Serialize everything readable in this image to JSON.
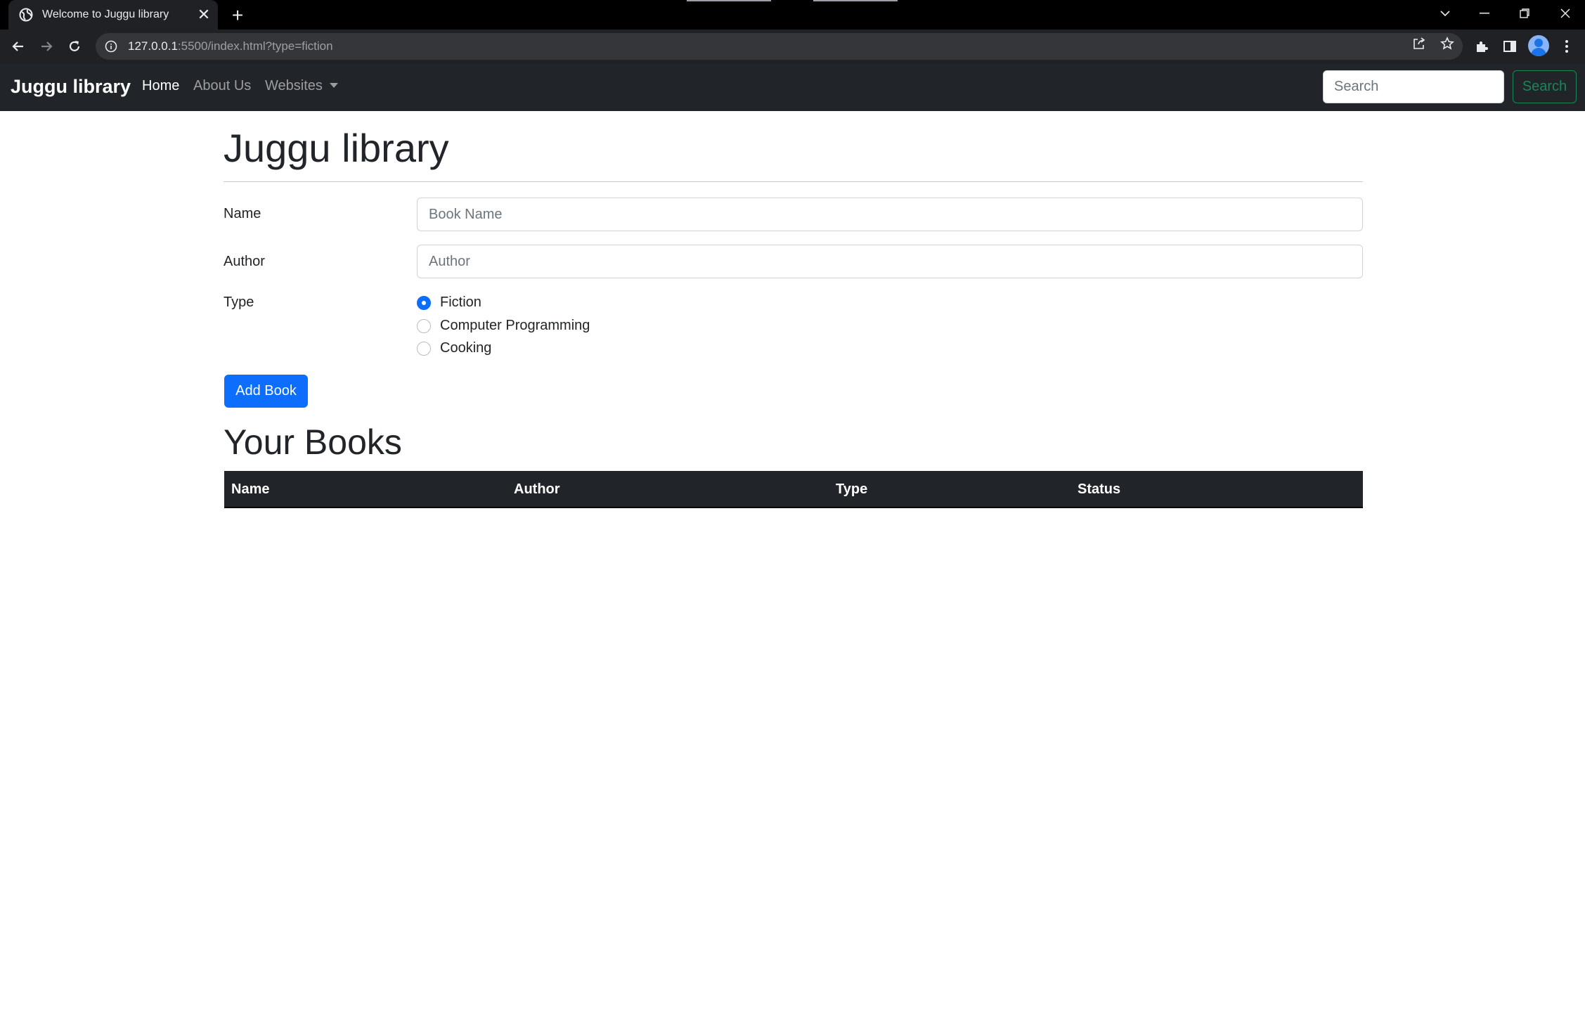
{
  "browser": {
    "tab_title": "Welcome to Juggu library",
    "url_host": "127.0.0.1",
    "url_rest": ":5500/index.html?type=fiction"
  },
  "navbar": {
    "brand": "Juggu library",
    "links": [
      {
        "label": "Home",
        "active": true
      },
      {
        "label": "About Us",
        "active": false
      },
      {
        "label": "Websites",
        "active": false
      }
    ],
    "search_placeholder": "Search",
    "search_button": "Search"
  },
  "main": {
    "title": "Juggu library",
    "form": {
      "name_label": "Name",
      "name_placeholder": "Book Name",
      "author_label": "Author",
      "author_placeholder": "Author",
      "type_label": "Type",
      "types": [
        {
          "label": "Fiction",
          "checked": true
        },
        {
          "label": "Computer Programming",
          "checked": false
        },
        {
          "label": "Cooking",
          "checked": false
        }
      ],
      "submit_label": "Add Book"
    },
    "books_title": "Your Books",
    "table_headers": [
      "Name",
      "Author",
      "Type",
      "Status"
    ]
  },
  "colors": {
    "navbar_bg": "#212529",
    "primary": "#0d6efd",
    "success": "#198754"
  }
}
